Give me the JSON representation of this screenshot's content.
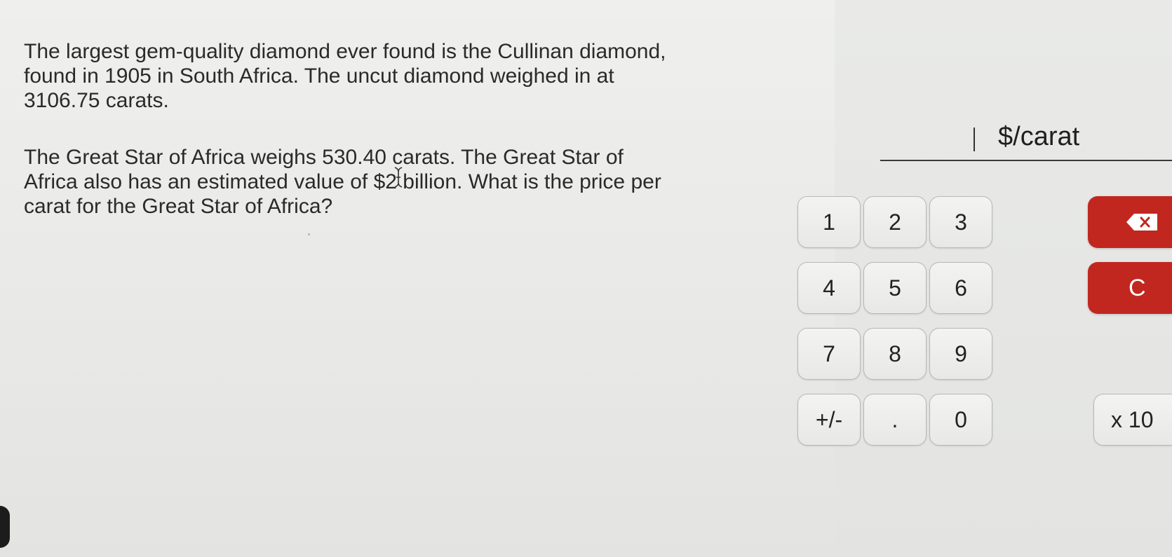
{
  "question": {
    "paragraph1": "The largest gem-quality diamond ever found is the Cullinan diamond,\nfound in 1905 in South Africa. The uncut diamond weighed in at\n3106.75 carats.",
    "paragraph2": "The Great Star of Africa weighs 530.40 carats. The Great Star of\nAfrica also has an estimated value of $2 billion. What is the price per\ncarat for the Great Star of Africa?"
  },
  "answer": {
    "value": "",
    "unit": "$/carat"
  },
  "keypad": {
    "digits": [
      "1",
      "2",
      "3",
      "4",
      "5",
      "6",
      "7",
      "8",
      "9"
    ],
    "sign": "+/-",
    "decimal": ".",
    "zero": "0",
    "clear": "C",
    "exponent": "x 10",
    "backspace_icon": "backspace-icon"
  }
}
